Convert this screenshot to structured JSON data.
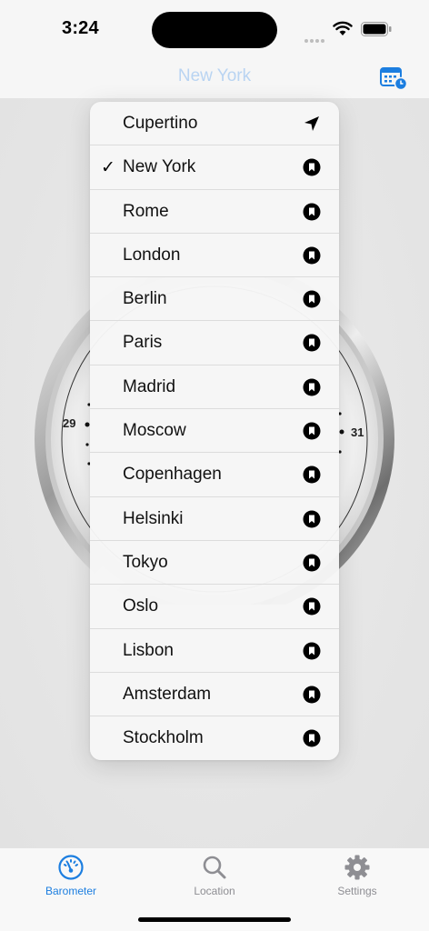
{
  "status_bar": {
    "time": "3:24"
  },
  "nav": {
    "title": "New York"
  },
  "gauge": {
    "left_label": "29",
    "right_label": "31"
  },
  "menu": {
    "items": [
      {
        "label": "Cupertino",
        "checked": false,
        "icon": "location-arrow-icon"
      },
      {
        "label": "New York",
        "checked": true,
        "icon": "bookmark-icon"
      },
      {
        "label": "Rome",
        "checked": false,
        "icon": "bookmark-icon"
      },
      {
        "label": "London",
        "checked": false,
        "icon": "bookmark-icon"
      },
      {
        "label": "Berlin",
        "checked": false,
        "icon": "bookmark-icon"
      },
      {
        "label": "Paris",
        "checked": false,
        "icon": "bookmark-icon"
      },
      {
        "label": "Madrid",
        "checked": false,
        "icon": "bookmark-icon"
      },
      {
        "label": "Moscow",
        "checked": false,
        "icon": "bookmark-icon"
      },
      {
        "label": "Copenhagen",
        "checked": false,
        "icon": "bookmark-icon"
      },
      {
        "label": "Helsinki",
        "checked": false,
        "icon": "bookmark-icon"
      },
      {
        "label": "Tokyo",
        "checked": false,
        "icon": "bookmark-icon"
      },
      {
        "label": "Oslo",
        "checked": false,
        "icon": "bookmark-icon"
      },
      {
        "label": "Lisbon",
        "checked": false,
        "icon": "bookmark-icon"
      },
      {
        "label": "Amsterdam",
        "checked": false,
        "icon": "bookmark-icon"
      },
      {
        "label": "Stockholm",
        "checked": false,
        "icon": "bookmark-icon"
      }
    ],
    "check_glyph": "✓"
  },
  "tabs": [
    {
      "label": "Barometer",
      "active": true,
      "icon": "gauge-icon"
    },
    {
      "label": "Location",
      "active": false,
      "icon": "search-icon"
    },
    {
      "label": "Settings",
      "active": false,
      "icon": "gear-icon"
    }
  ],
  "colors": {
    "accent": "#1c7ee0",
    "inactive": "#8e8e93",
    "nav_title": "#b9d4f2"
  }
}
